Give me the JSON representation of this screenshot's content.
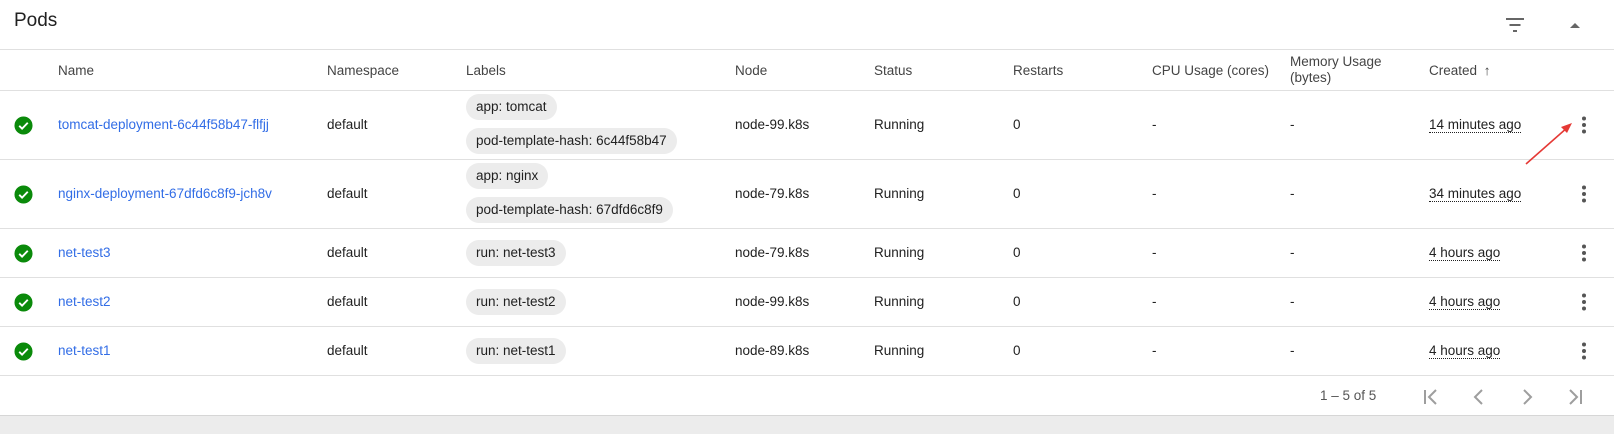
{
  "panel": {
    "title": "Pods"
  },
  "columns": {
    "name": "Name",
    "namespace": "Namespace",
    "labels": "Labels",
    "node": "Node",
    "status": "Status",
    "restarts": "Restarts",
    "cpu": "CPU Usage (cores)",
    "memory_line1": "Memory Usage",
    "memory_line2": "(bytes)",
    "created": "Created",
    "sort_arrow": "↑"
  },
  "rows": [
    {
      "name": "tomcat-deployment-6c44f58b47-flfjj",
      "namespace": "default",
      "labels": [
        "app: tomcat",
        "pod-template-hash: 6c44f58b47"
      ],
      "node": "node-99.k8s",
      "status": "Running",
      "restarts": "0",
      "cpu": "-",
      "memory": "-",
      "created": "14 minutes ago"
    },
    {
      "name": "nginx-deployment-67dfd6c8f9-jch8v",
      "namespace": "default",
      "labels": [
        "app: nginx",
        "pod-template-hash: 67dfd6c8f9"
      ],
      "node": "node-79.k8s",
      "status": "Running",
      "restarts": "0",
      "cpu": "-",
      "memory": "-",
      "created": "34 minutes ago"
    },
    {
      "name": "net-test3",
      "namespace": "default",
      "labels": [
        "run: net-test3"
      ],
      "node": "node-79.k8s",
      "status": "Running",
      "restarts": "0",
      "cpu": "-",
      "memory": "-",
      "created": "4 hours ago"
    },
    {
      "name": "net-test2",
      "namespace": "default",
      "labels": [
        "run: net-test2"
      ],
      "node": "node-99.k8s",
      "status": "Running",
      "restarts": "0",
      "cpu": "-",
      "memory": "-",
      "created": "4 hours ago"
    },
    {
      "name": "net-test1",
      "namespace": "default",
      "labels": [
        "run: net-test1"
      ],
      "node": "node-89.k8s",
      "status": "Running",
      "restarts": "0",
      "cpu": "-",
      "memory": "-",
      "created": "4 hours ago"
    }
  ],
  "pagination": {
    "range": "1 – 5 of 5"
  },
  "colors": {
    "link": "#326de6",
    "running": "#0a8a0a",
    "annotation_arrow": "#e53935"
  },
  "icons": [
    "filter-icon",
    "collapse-icon",
    "check-circle-icon",
    "more-vert-icon",
    "first-page-icon",
    "prev-page-icon",
    "next-page-icon",
    "last-page-icon"
  ]
}
